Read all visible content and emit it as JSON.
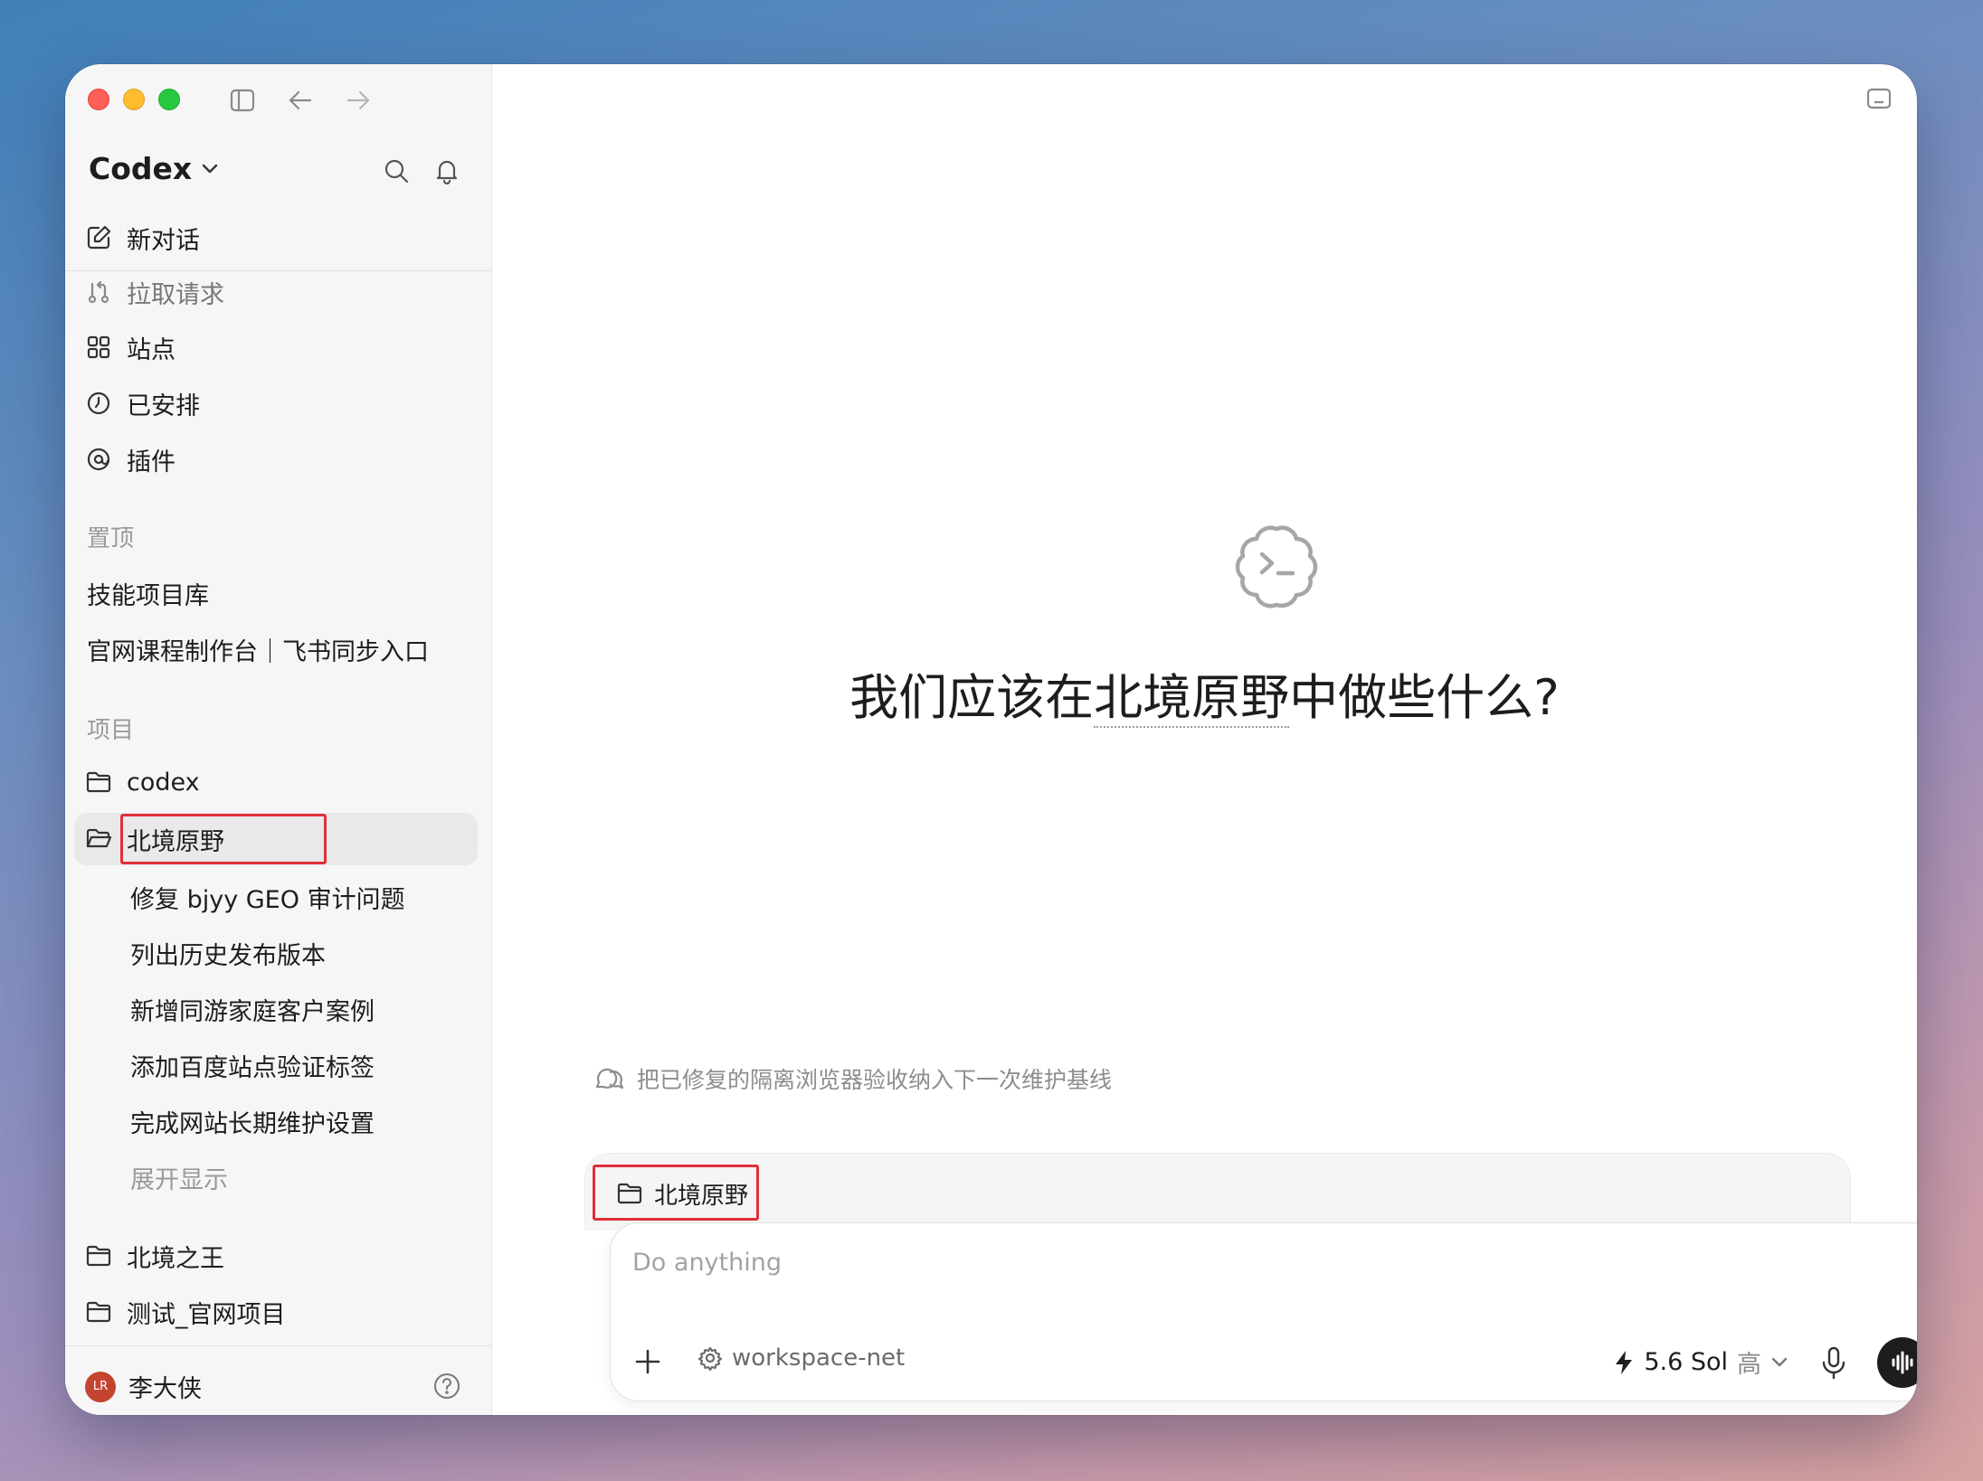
{
  "sidebar": {
    "brand": "Codex",
    "nav": [
      {
        "label": "新对话",
        "icon": "new-chat-icon"
      },
      {
        "label": "拉取请求",
        "icon": "pull-request-icon"
      },
      {
        "label": "站点",
        "icon": "sites-icon"
      },
      {
        "label": "已安排",
        "icon": "clock-icon"
      },
      {
        "label": "插件",
        "icon": "plugin-icon"
      }
    ],
    "pinned_label": "置顶",
    "pinned": [
      "技能项目库",
      "官网课程制作台｜飞书同步入口"
    ],
    "projects_label": "项目",
    "projects": [
      "codex",
      "北境原野",
      "北境之王",
      "测试_官网项目"
    ],
    "threads": [
      "修复 bjyy GEO 审计问题",
      "列出历史发布版本",
      "新增同游家庭客户案例",
      "添加百度站点验证标签",
      "完成网站长期维护设置"
    ],
    "expand_label": "展开显示",
    "user": {
      "initials": "LR",
      "name": "李大侠"
    }
  },
  "main": {
    "hero_prefix": "我们应该在",
    "hero_project": "北境原野",
    "hero_suffix": "中做些什么?",
    "suggestion": "把已修复的隔离浏览器验收纳入下一次维护基线",
    "tray_project": "北境原野",
    "composer": {
      "placeholder": "Do anything",
      "environment": "workspace-net",
      "model": "5.6 Sol",
      "effort": "高"
    }
  },
  "colors": {
    "highlight": "#e0303a",
    "accent_dark": "#1d1d1d"
  }
}
